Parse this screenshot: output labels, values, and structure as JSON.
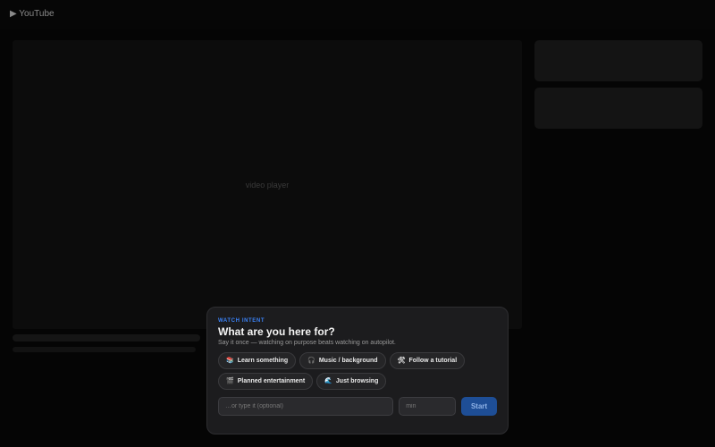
{
  "header": {
    "brand": "▶ YouTube"
  },
  "player": {
    "label": "video player"
  },
  "intent_modal": {
    "eyebrow": "WATCH INTENT",
    "title": "What are you here for?",
    "subtitle": "Say it once — watching on purpose beats watching on autopilot.",
    "options": [
      {
        "icon": "books-icon",
        "glyph": "📚",
        "label": "Learn something"
      },
      {
        "icon": "headphones-icon",
        "glyph": "🎧",
        "label": "Music / background"
      },
      {
        "icon": "tools-icon",
        "glyph": "🛠",
        "label": "Follow a tutorial"
      },
      {
        "icon": "clapper-icon",
        "glyph": "🎬",
        "label": "Planned entertainment"
      },
      {
        "icon": "wave-icon",
        "glyph": "🌊",
        "label": "Just browsing"
      }
    ],
    "intent_placeholder": "…or type it (optional)",
    "minutes_placeholder": "min",
    "start_label": "Start"
  }
}
